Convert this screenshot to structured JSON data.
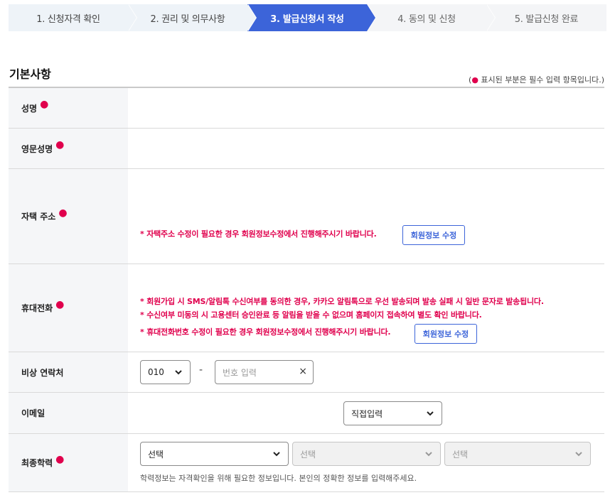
{
  "steps": [
    {
      "label": "1. 신청자격 확인",
      "state": "done"
    },
    {
      "label": "2. 권리 및 의무사항",
      "state": "done"
    },
    {
      "label": "3. 발급신청서 작성",
      "state": "active"
    },
    {
      "label": "4. 동의 및 신청",
      "state": "future"
    },
    {
      "label": "5. 발급신청 완료",
      "state": "future"
    }
  ],
  "section": {
    "title": "기본사항",
    "req_note_prefix": "(",
    "req_note_text": " 표시된 부분은 필수 입력 항목입니다.)",
    "req_dot": "●"
  },
  "rows": {
    "name": {
      "label": "성명"
    },
    "eng_name": {
      "label": "영문성명"
    },
    "address": {
      "label": "자택 주소",
      "warning": "자택주소 수정이 필요한 경우 회원정보수정에서 진행해주시기 바랍니다.",
      "button": "회원정보 수정"
    },
    "mobile": {
      "label": "휴대전화",
      "warnings": [
        "회원가입 시 SMS/알림톡 수신여부를 동의한 경우, 카카오 알림톡으로 우선 발송되며 발송 실패 시 일반 문자로 발송됩니다.",
        "수신여부 미동의 시 고용센터 승인완료 등 알림을 받을 수 없으며 홈페이지 접속하여 별도 확인 바랍니다.",
        "휴대전화번호 수정이 필요한 경우 회원정보수정에서 진행해주시기 바랍니다."
      ],
      "button": "회원정보 수정"
    },
    "emergency": {
      "label": "비상 연락처",
      "prefix_value": "010",
      "dash": "-",
      "number_placeholder": "번호 입력",
      "clear": "×"
    },
    "email": {
      "label": "이메일",
      "domain_select": "직접입력"
    },
    "education": {
      "label": "최종학력",
      "select1": "선택",
      "select2": "선택",
      "select3": "선택",
      "hint": "학력정보는 자격확인을 위해 필요한 정보입니다. 본인의 정확한 정보를 입력해주세요."
    }
  },
  "colors": {
    "accent": "#3c64d9",
    "required": "#e0004d"
  }
}
